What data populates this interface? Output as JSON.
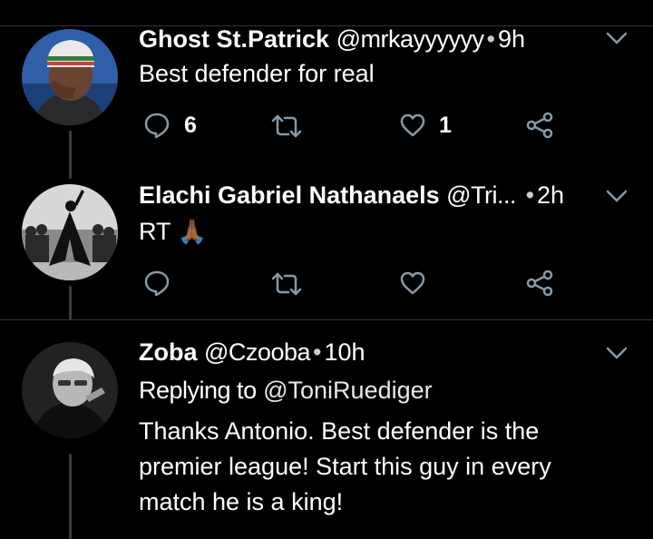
{
  "tweets": [
    {
      "name": "Ghost St.Patrick",
      "handle": "@mrkayyyyyy",
      "separator": "•",
      "time": "9h",
      "text": "Best defender for real",
      "reply_count": "6",
      "like_count": "1"
    },
    {
      "name": "Elachi Gabriel Nathanaels",
      "handle": "@Tri...",
      "separator": "•",
      "time": "2h",
      "text": "RT",
      "emoji": "🙏🏾"
    },
    {
      "name": "Zoba",
      "handle": "@Czooba",
      "separator": "•",
      "time": "10h",
      "replying_label": "Replying to",
      "replying_handle": "@ToniRuediger",
      "text": "Thanks Antonio. Best defender is the premier league! Start this guy in every match he is a king!"
    }
  ],
  "icons": {
    "reply": "comment-bubble-icon",
    "retweet": "retweet-icon",
    "like": "heart-icon",
    "share": "share-icon",
    "menu": "chevron-down-icon"
  },
  "colors": {
    "background": "#000000",
    "text": "#ffffff",
    "icon": "#8899a6",
    "divider": "#2f3336"
  }
}
